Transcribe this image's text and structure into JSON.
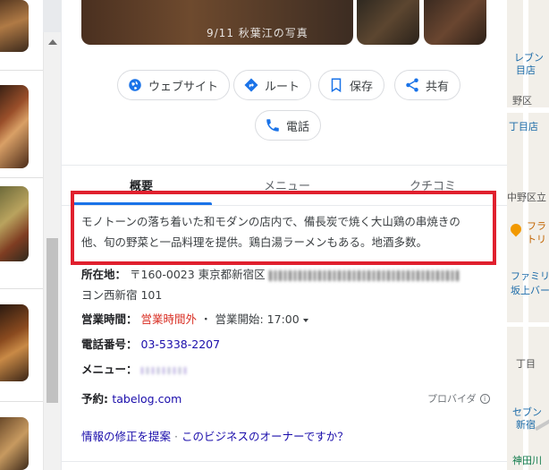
{
  "photos": {
    "caption": "9/11 秋葉江の写真"
  },
  "actions": {
    "website": "ウェブサイト",
    "route": "ルート",
    "save": "保存",
    "share": "共有",
    "phone": "電話"
  },
  "tabs": {
    "overview": "概要",
    "menu": "メニュー",
    "reviews": "クチコミ"
  },
  "description": {
    "line1": "モノトーンの落ち着いた和モダンの店内で、備長炭で焼く大山鶏の串焼きの",
    "line2": "他、旬の野菜と一品料理を提供。鶏白湯ラーメンもある。地酒多数。"
  },
  "info": {
    "address_label": "所在地：",
    "address_value": "〒160-0023 東京都新宿区",
    "address_line2": "ヨン西新宿 101",
    "hours_label": "営業時間：",
    "hours_status": "営業時間外",
    "hours_separator": "・",
    "hours_open": "営業開始: 17:00",
    "phone_label": "電話番号：",
    "phone_value": "03-5338-2207",
    "menu_label": "メニュー：",
    "reservation_label": "予約: ",
    "reservation_value": "tabelog.com",
    "provider": "プロバイダ",
    "provider_icon": "i"
  },
  "footer": {
    "suggest_edit": "情報の修正を提案",
    "separator": "·",
    "owner_question": "このビジネスのオーナーですか？"
  },
  "map": {
    "labels": [
      "レブン",
      "目店",
      "野区",
      "丁目店",
      "中野区立",
      "フラ",
      "トリ",
      "ファミリ",
      "坂上バー",
      "丁目",
      "セブン",
      "新宿",
      "神田川"
    ]
  },
  "colors": {
    "accent": "#1a73e8",
    "highlight": "#e0202e",
    "closed": "#d93025",
    "link": "#1a0dab"
  }
}
